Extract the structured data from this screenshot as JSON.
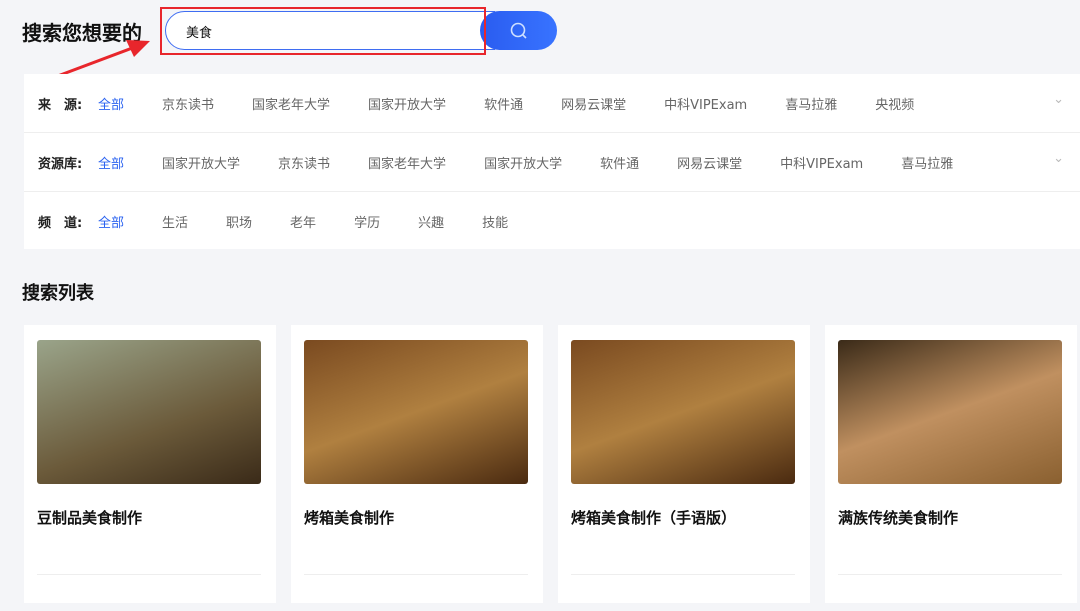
{
  "header": {
    "title": "搜索您想要的",
    "search_value": "美食"
  },
  "filters": [
    {
      "label": "来　源:",
      "items": [
        "全部",
        "京东读书",
        "国家老年大学",
        "国家开放大学",
        "软件通",
        "网易云课堂",
        "中科VIPExam",
        "喜马拉雅",
        "央视频"
      ],
      "expandable": true
    },
    {
      "label": "资源库:",
      "items": [
        "全部",
        "国家开放大学",
        "京东读书",
        "国家老年大学",
        "国家开放大学",
        "软件通",
        "网易云课堂",
        "中科VIPExam",
        "喜马拉雅"
      ],
      "expandable": true
    },
    {
      "label": "频　道:",
      "items": [
        "全部",
        "生活",
        "职场",
        "老年",
        "学历",
        "兴趣",
        "技能"
      ],
      "expandable": false
    }
  ],
  "results": {
    "title": "搜索列表",
    "cards": [
      {
        "title": "豆制品美食制作"
      },
      {
        "title": "烤箱美食制作"
      },
      {
        "title": "烤箱美食制作（手语版）"
      },
      {
        "title": "满族传统美食制作"
      }
    ]
  },
  "colors": {
    "accent": "#2b63f0",
    "annotation": "#e8262c"
  }
}
